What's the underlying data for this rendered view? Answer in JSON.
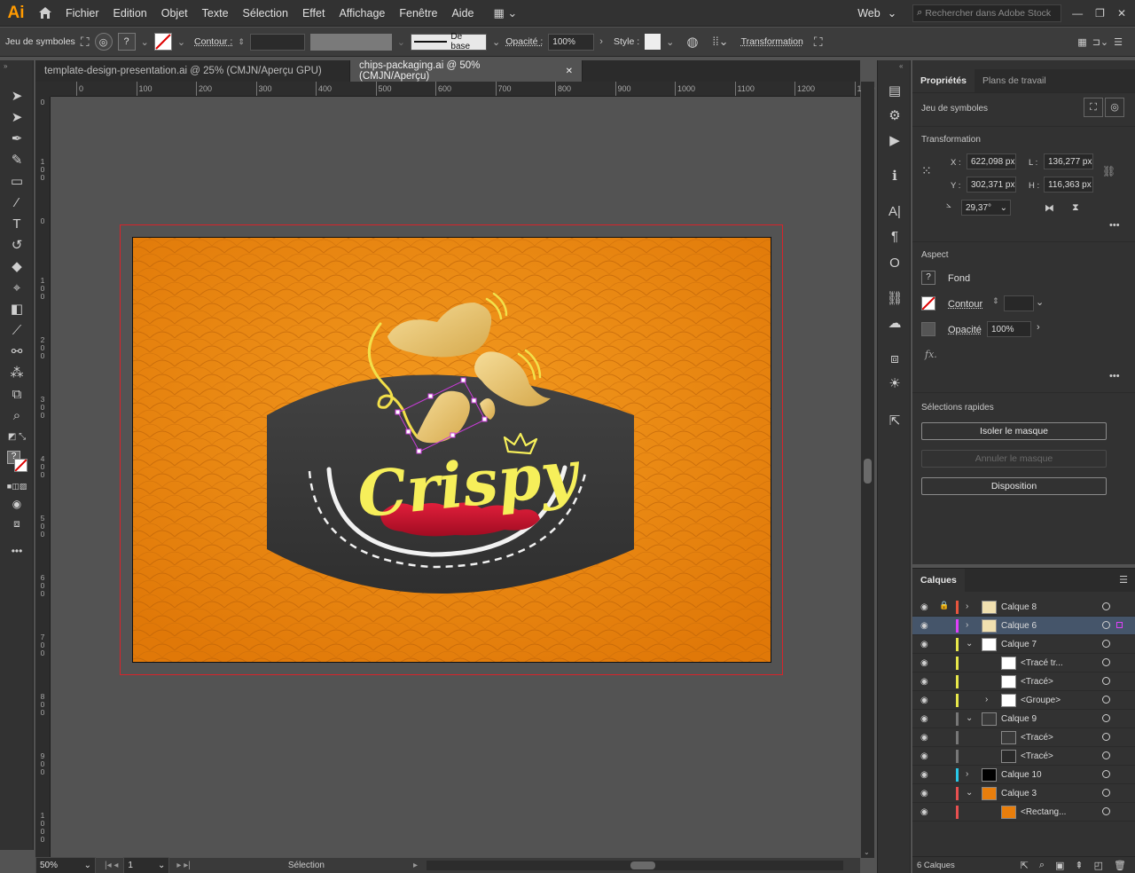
{
  "app": {
    "logo": "Ai",
    "accent": "#ff9a00"
  },
  "menu": [
    "Fichier",
    "Edition",
    "Objet",
    "Texte",
    "Sélection",
    "Effet",
    "Affichage",
    "Fenêtre",
    "Aide"
  ],
  "workspace": "Web",
  "search": {
    "placeholder": "Rechercher dans Adobe Stock"
  },
  "control_bar": {
    "selection_type": "Jeu de symboles",
    "contour_label": "Contour :",
    "stroke_style": "De base",
    "opacity_label": "Opacité :",
    "opacity_value": "100%",
    "style_label": "Style :",
    "transform_label": "Transformation"
  },
  "tabs": [
    {
      "label": "template-design-presentation.ai @ 25% (CMJN/Aperçu GPU)",
      "active": false
    },
    {
      "label": "chips-packaging.ai @ 50% (CMJN/Aperçu)",
      "active": true
    }
  ],
  "ruler_h": [
    "0",
    "100",
    "200",
    "300",
    "400",
    "500",
    "600",
    "700",
    "800",
    "900",
    "1000",
    "1100",
    "1200",
    "1300"
  ],
  "ruler_v": [
    "0",
    "1 0 0",
    "0",
    "1 0 0",
    "2 0 0",
    "3 0 0",
    "4 0 0",
    "5 0 0",
    "6 0 0",
    "7 0 0",
    "8 0 0",
    "9 0 0",
    "1 0 0 0"
  ],
  "artwork": {
    "logo_text": "Crispy",
    "bg_color": "#e87e0c",
    "badge_color": "#3a3a3a",
    "text_color": "#f6ef5a",
    "sauce_color": "#c8102e"
  },
  "status": {
    "zoom": "50%",
    "page": "1",
    "tool": "Sélection"
  },
  "properties": {
    "tabs": [
      "Propriétés",
      "Plans de travail"
    ],
    "selection_type": "Jeu de symboles",
    "transform_title": "Transformation",
    "x_label": "X :",
    "x": "622,098 px",
    "y_label": "Y :",
    "y": "302,371 px",
    "w_label": "L :",
    "w": "136,277 px",
    "h_label": "H :",
    "h": "116,363 px",
    "angle": "29,37°",
    "aspect_title": "Aspect",
    "fill_label": "Fond",
    "stroke_label": "Contour",
    "opacity_label": "Opacité",
    "opacity": "100%",
    "quick_title": "Sélections rapides",
    "btn_isolate": "Isoler le masque",
    "btn_cancel": "Annuler le masque",
    "btn_arrange": "Disposition"
  },
  "layers": {
    "title": "Calques",
    "count": "6 Calques",
    "rows": [
      {
        "name": "Calque 8",
        "color": "#e8553e",
        "indent": 0,
        "expand": ">",
        "thumb": "#f0e0b0"
      },
      {
        "name": "Calque 6",
        "color": "#e040fb",
        "indent": 0,
        "expand": ">",
        "thumb": "#f0e0b0",
        "selected": true
      },
      {
        "name": "Calque 7",
        "color": "#e8e84a",
        "indent": 0,
        "expand": "v",
        "thumb": "#ffffff"
      },
      {
        "name": "<Tracé tr...",
        "color": "#e8e84a",
        "indent": 1,
        "expand": "",
        "thumb": "#ffffff"
      },
      {
        "name": "<Tracé>",
        "color": "#e8e84a",
        "indent": 1,
        "expand": "",
        "thumb": "#ffffff"
      },
      {
        "name": "<Groupe>",
        "color": "#e8e84a",
        "indent": 1,
        "expand": ">",
        "thumb": "#ffffff"
      },
      {
        "name": "Calque 9",
        "color": "#777777",
        "indent": 0,
        "expand": "v",
        "thumb": "#3a3a3a"
      },
      {
        "name": "<Tracé>",
        "color": "#777777",
        "indent": 1,
        "expand": "",
        "thumb": "#3a3a3a"
      },
      {
        "name": "<Tracé>",
        "color": "#777777",
        "indent": 1,
        "expand": "",
        "thumb": "#2a2a2a"
      },
      {
        "name": "Calque 10",
        "color": "#28c8e8",
        "indent": 0,
        "expand": ">",
        "thumb": "#000000"
      },
      {
        "name": "Calque 3",
        "color": "#e85050",
        "indent": 0,
        "expand": "v",
        "thumb": "#e87e0c"
      },
      {
        "name": "<Rectang...",
        "color": "#e85050",
        "indent": 1,
        "expand": "",
        "thumb": "#e87e0c"
      }
    ]
  }
}
